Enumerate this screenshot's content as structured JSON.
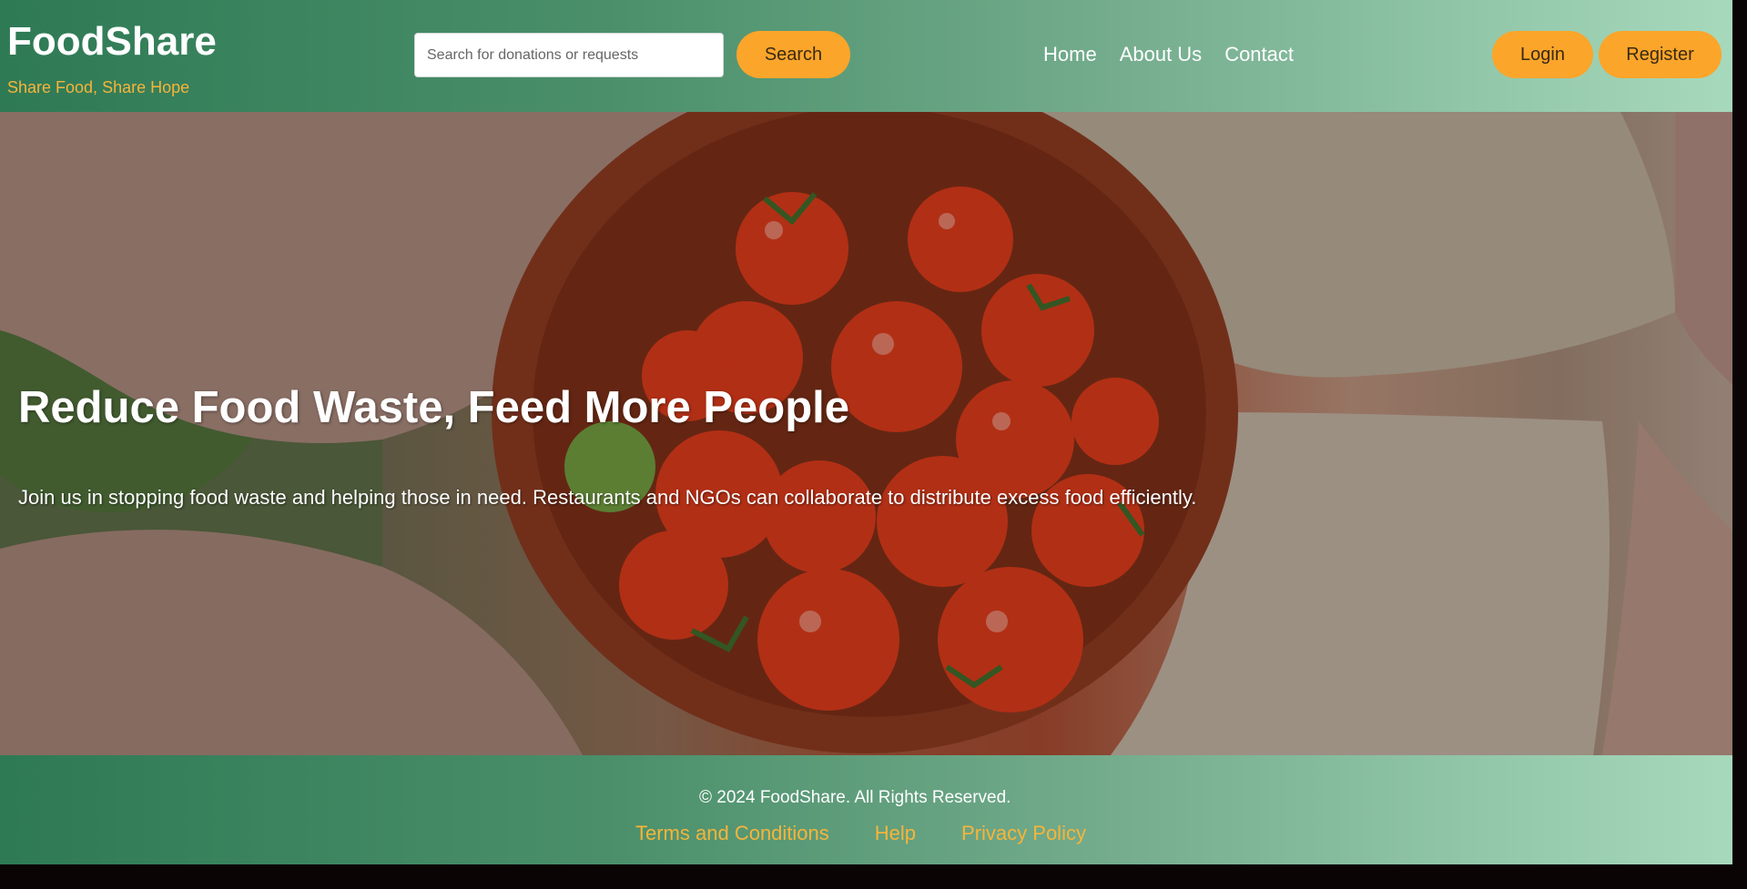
{
  "header": {
    "brand": {
      "title": "FoodShare",
      "tagline": "Share Food, Share Hope"
    },
    "search": {
      "placeholder": "Search for donations or requests",
      "button_label": "Search"
    },
    "nav": [
      {
        "label": "Home"
      },
      {
        "label": "About Us"
      },
      {
        "label": "Contact"
      }
    ],
    "auth": {
      "login_label": "Login",
      "register_label": "Register"
    }
  },
  "hero": {
    "title": "Reduce Food Waste, Feed More People",
    "text": "Join us in stopping food waste and helping those in need. Restaurants and NGOs can collaborate to distribute excess food efficiently."
  },
  "footer": {
    "copyright": "© 2024 FoodShare. All Rights Reserved.",
    "links": [
      {
        "label": "Terms and Conditions"
      },
      {
        "label": "Help"
      },
      {
        "label": "Privacy Policy"
      }
    ]
  },
  "colors": {
    "accent": "#fba52b",
    "tagline": "#f7b43a",
    "header_green_dark": "#2e7a55",
    "header_green_light": "#a7d9bc"
  }
}
